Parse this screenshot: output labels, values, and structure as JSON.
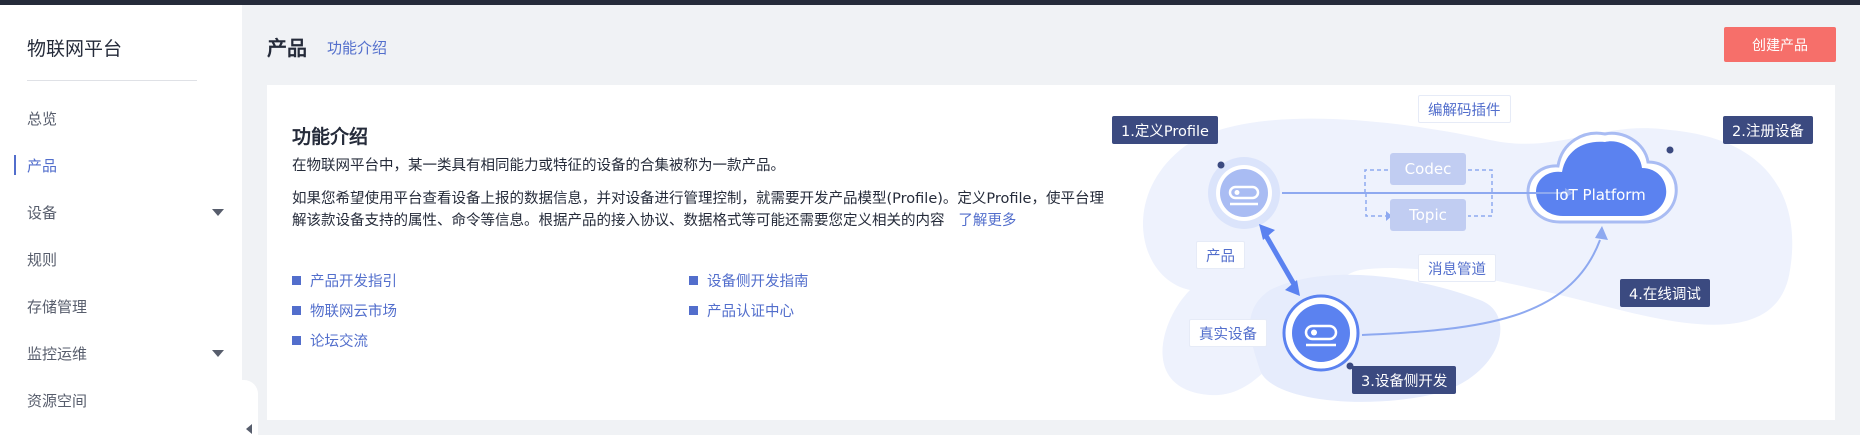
{
  "sidebar": {
    "title": "物联网平台",
    "items": [
      {
        "label": "总览"
      },
      {
        "label": "产品"
      },
      {
        "label": "设备"
      },
      {
        "label": "规则"
      },
      {
        "label": "存储管理"
      },
      {
        "label": "监控运维"
      },
      {
        "label": "资源空间"
      }
    ]
  },
  "header": {
    "title": "产品",
    "link": "功能介绍",
    "create_button": "创建产品"
  },
  "intro": {
    "title": "功能介绍",
    "p1": "在物联网平台中，某一类具有相同能力或特征的设备的合集被称为一款产品。",
    "p2": "如果您希望使用平台查看设备上报的数据信息，并对设备进行管理控制，就需要开发产品模型(Profile)。定义Profile，使平台理解该款设备支持的属性、命令等信息。根据产品的接入协议、数据格式等可能还需要您定义相关的内容",
    "learn_more": "了解更多",
    "links": [
      {
        "label": "产品开发指引"
      },
      {
        "label": "设备侧开发指南"
      },
      {
        "label": "物联网云市场"
      },
      {
        "label": "产品认证中心"
      },
      {
        "label": "论坛交流"
      }
    ]
  },
  "diagram": {
    "step1": "1.定义Profile",
    "step2": "2.注册设备",
    "step3": "3.设备侧开发",
    "step4": "4.在线调试",
    "codec_plugin": "编解码插件",
    "codec": "Codec",
    "topic": "Topic",
    "msg_pipe": "消息管道",
    "product": "产品",
    "real_device": "真实设备",
    "iot_platform": "IoT Platform"
  },
  "colors": {
    "accent": "#526ecc",
    "create_button": "#f66f6a",
    "dark_label": "#3b4a80",
    "cloud": "#5b82f0"
  }
}
